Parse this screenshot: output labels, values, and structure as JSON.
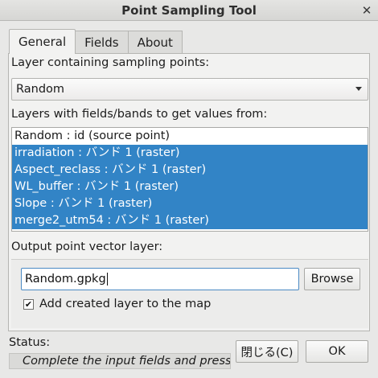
{
  "window": {
    "title": "Point Sampling Tool",
    "close_glyph": "✕"
  },
  "tabs": [
    {
      "label": "General",
      "active": true
    },
    {
      "label": "Fields",
      "active": false
    },
    {
      "label": "About",
      "active": false
    }
  ],
  "general": {
    "sampling_layer_label": "Layer containing sampling points:",
    "sampling_layer_value": "Random",
    "value_layers_label": "Layers with fields/bands to get values from:",
    "value_layers": [
      {
        "label": "Random : id (source point)",
        "selected": false
      },
      {
        "label": "irradiation : バンド 1 (raster)",
        "selected": true
      },
      {
        "label": "Aspect_reclass : バンド 1 (raster)",
        "selected": true
      },
      {
        "label": "WL_buffer : バンド 1 (raster)",
        "selected": true
      },
      {
        "label": "Slope : バンド 1 (raster)",
        "selected": true
      },
      {
        "label": "merge2_utm54 : バンド 1 (raster)",
        "selected": true
      }
    ],
    "output_label": "Output point vector layer:",
    "output_value": "Random.gpkg",
    "browse_label": "Browse",
    "add_to_map_label": "Add created layer to the map",
    "add_to_map_checked": true,
    "check_glyph": "✔"
  },
  "footer": {
    "status_label": "Status:",
    "status_text": "Complete the input fields and press OK...",
    "close_button_label": "閉じる(C)",
    "ok_button_label": "OK"
  },
  "colors": {
    "selection": "#3284c6",
    "focus_border": "#4a8ac4"
  }
}
